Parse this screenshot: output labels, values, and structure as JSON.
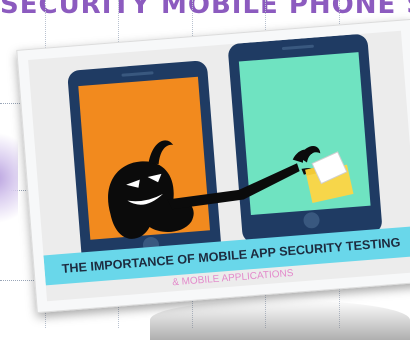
{
  "header": {
    "banner_text": "SECURITY MOBILE PHONE SECURITY"
  },
  "card": {
    "title": "THE IMPORTANCE OF MOBILE APP SECURITY TESTING",
    "subtitle": "& MOBILE APPLICATIONS"
  },
  "colors": {
    "banner": "#69d7ea",
    "left_phone_screen": "#f28a1e",
    "right_phone_screen": "#6fe3c1",
    "phone_frame": "#1f3b63",
    "folder": "#f7d64a"
  },
  "icons": [
    "hacker-icon",
    "folder-icon",
    "document-icon"
  ]
}
